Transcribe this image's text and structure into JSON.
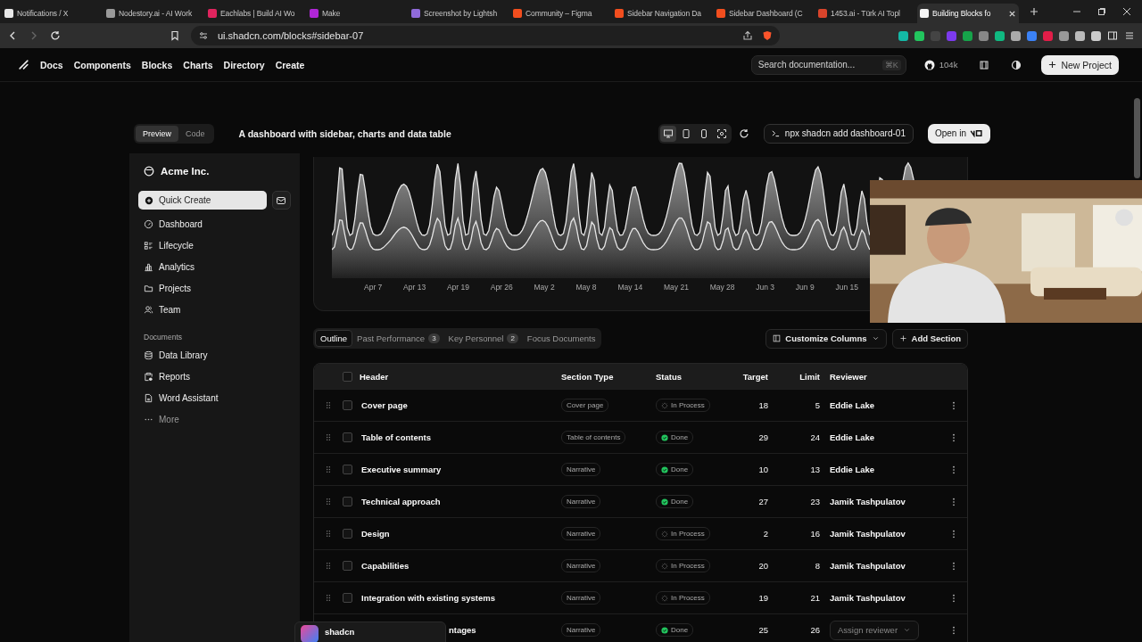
{
  "browser": {
    "tabs": [
      {
        "title": "Notifications / X",
        "selected": false,
        "color": "#e7e7e7"
      },
      {
        "title": "Nodestory.ai - AI Work",
        "selected": false,
        "color": "#9a9a9a"
      },
      {
        "title": "Eachlabs | Build AI Wo",
        "selected": false,
        "color": "#e0245e"
      },
      {
        "title": "Make",
        "selected": false,
        "color": "#b026d6"
      },
      {
        "title": "Screenshot by Lightsh",
        "selected": false,
        "color": "#8f6ad9"
      },
      {
        "title": "Community – Figma",
        "selected": false,
        "color": "#f24e1e"
      },
      {
        "title": "Sidebar Navigation Da",
        "selected": false,
        "color": "#f24e1e"
      },
      {
        "title": "Sidebar Dashboard (C",
        "selected": false,
        "color": "#f24e1e"
      },
      {
        "title": "1453.ai - Türk AI Topl",
        "selected": false,
        "color": "#d9442b"
      },
      {
        "title": "Building Blocks fo",
        "selected": true,
        "color": "#f5f5f5"
      }
    ],
    "url": "ui.shadcn.com/blocks#sidebar-07"
  },
  "site_nav": {
    "links": [
      "Docs",
      "Components",
      "Blocks",
      "Charts",
      "Directory",
      "Create"
    ],
    "search": {
      "placeholder": "Search documentation...",
      "shortcut": "⌘K"
    },
    "github_stars": "104k",
    "new_project": "New Project"
  },
  "block": {
    "toggle": [
      {
        "label": "Preview",
        "selected": true
      },
      {
        "label": "Code",
        "selected": false
      }
    ],
    "description": "A dashboard with sidebar, charts and data table",
    "devices": [
      {
        "kind": "desktop",
        "selected": true
      },
      {
        "kind": "tablet",
        "selected": false
      },
      {
        "kind": "phone",
        "selected": false
      },
      {
        "kind": "fullscreen",
        "selected": false
      }
    ],
    "command": "npx shadcn add dashboard-01",
    "open_in": "Open in"
  },
  "sidebar": {
    "brand": "Acme Inc.",
    "quick_create": "Quick Create",
    "nav": [
      {
        "label": "Dashboard",
        "kind": "gauge"
      },
      {
        "label": "Lifecycle",
        "kind": "list"
      },
      {
        "label": "Analytics",
        "kind": "bars"
      },
      {
        "label": "Projects",
        "kind": "folder"
      },
      {
        "label": "Team",
        "kind": "users"
      }
    ],
    "documents_heading": "Documents",
    "documents": [
      {
        "label": "Data Library",
        "kind": "database"
      },
      {
        "label": "Reports",
        "kind": "clipboard"
      },
      {
        "label": "Word Assistant",
        "kind": "file"
      }
    ],
    "more": "More",
    "user": {
      "name": "shadcn"
    }
  },
  "chart": {
    "x_labels": [
      "Apr 7",
      "Apr 13",
      "Apr 19",
      "Apr 26",
      "May 2",
      "May 8",
      "May 14",
      "May 21",
      "May 28",
      "Jun 3",
      "Jun 9",
      "Jun 15"
    ]
  },
  "section_tabs": [
    {
      "label": "Outline",
      "selected": true
    },
    {
      "label": "Past Performance",
      "count": "3",
      "selected": false
    },
    {
      "label": "Key Personnel",
      "count": "2",
      "selected": false
    },
    {
      "label": "Focus Documents",
      "selected": false
    }
  ],
  "customize_columns": "Customize Columns",
  "add_section": "Add Section",
  "table": {
    "columns": [
      "Header",
      "Section Type",
      "Status",
      "Target",
      "Limit",
      "Reviewer"
    ],
    "header_checked": false,
    "rows": [
      {
        "header": "Cover page",
        "section_type": "Cover page",
        "status": {
          "kind": "in_process",
          "label": "In Process"
        },
        "target": "18",
        "limit": "5",
        "reviewer": {
          "kind": "name",
          "text": "Eddie Lake"
        },
        "checked": false,
        "obscured": false
      },
      {
        "header": "Table of contents",
        "section_type": "Table of contents",
        "status": {
          "kind": "done",
          "label": "Done"
        },
        "target": "29",
        "limit": "24",
        "reviewer": {
          "kind": "name",
          "text": "Eddie Lake"
        },
        "checked": false,
        "obscured": false
      },
      {
        "header": "Executive summary",
        "section_type": "Narrative",
        "status": {
          "kind": "done",
          "label": "Done"
        },
        "target": "10",
        "limit": "13",
        "reviewer": {
          "kind": "name",
          "text": "Eddie Lake"
        },
        "checked": false,
        "obscured": false
      },
      {
        "header": "Technical approach",
        "section_type": "Narrative",
        "status": {
          "kind": "done",
          "label": "Done"
        },
        "target": "27",
        "limit": "23",
        "reviewer": {
          "kind": "name",
          "text": "Jamik Tashpulatov"
        },
        "checked": false,
        "obscured": false
      },
      {
        "header": "Design",
        "section_type": "Narrative",
        "status": {
          "kind": "in_process",
          "label": "In Process"
        },
        "target": "2",
        "limit": "16",
        "reviewer": {
          "kind": "name",
          "text": "Jamik Tashpulatov"
        },
        "checked": false,
        "obscured": false
      },
      {
        "header": "Capabilities",
        "section_type": "Narrative",
        "status": {
          "kind": "in_process",
          "label": "In Process"
        },
        "target": "20",
        "limit": "8",
        "reviewer": {
          "kind": "name",
          "text": "Jamik Tashpulatov"
        },
        "checked": false,
        "obscured": false
      },
      {
        "header": "Integration with existing systems",
        "section_type": "Narrative",
        "status": {
          "kind": "in_process",
          "label": "In Process"
        },
        "target": "19",
        "limit": "21",
        "reviewer": {
          "kind": "name",
          "text": "Jamik Tashpulatov"
        },
        "checked": false,
        "obscured": false
      },
      {
        "header": "ntages",
        "section_type": "Narrative",
        "status": {
          "kind": "done",
          "label": "Done"
        },
        "target": "25",
        "limit": "26",
        "reviewer": {
          "kind": "select",
          "text": "Assign reviewer"
        },
        "obscured": true
      }
    ]
  }
}
